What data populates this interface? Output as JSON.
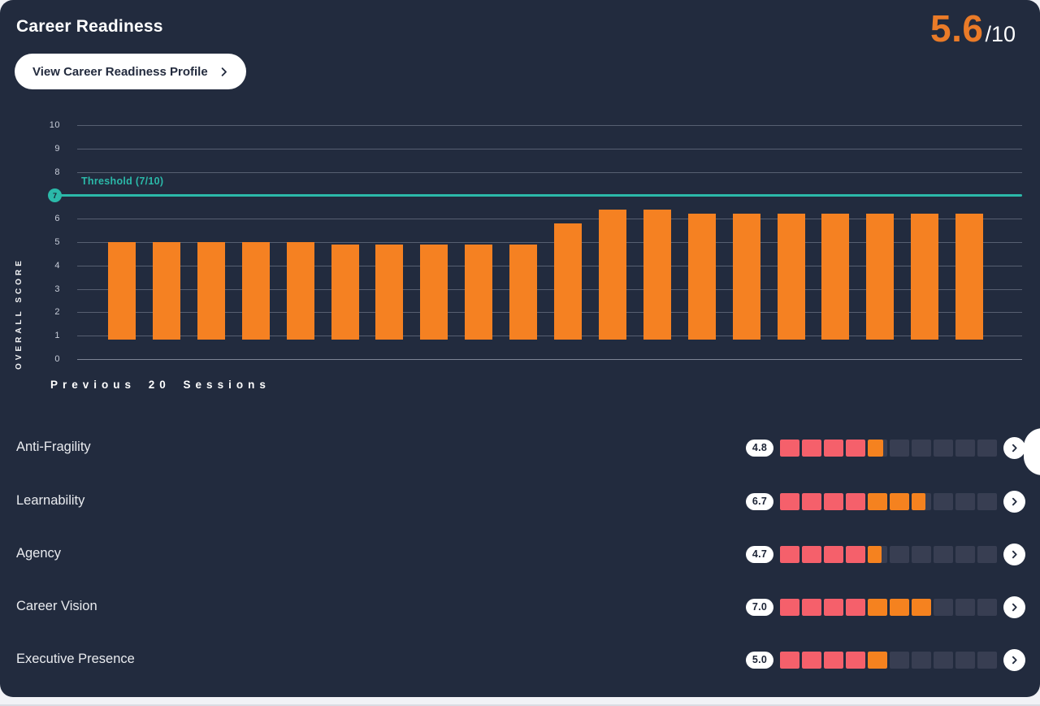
{
  "header": {
    "title": "Career Readiness",
    "score": "5.6",
    "score_max": "/10",
    "profile_button_label": "View Career Readiness Profile"
  },
  "chart_data": {
    "type": "bar",
    "title": "",
    "xlabel": "Previous 20 Sessions",
    "ylabel": "OVERALL SCORE",
    "ylim": [
      0,
      10
    ],
    "yticks": [
      0,
      1,
      2,
      3,
      4,
      5,
      6,
      7,
      8,
      9,
      10
    ],
    "grid": true,
    "values": [
      5.0,
      5.0,
      5.0,
      5.0,
      5.0,
      4.9,
      4.9,
      4.9,
      4.9,
      4.9,
      5.8,
      6.4,
      6.4,
      6.2,
      6.2,
      6.2,
      6.2,
      6.2,
      6.2,
      6.2
    ],
    "threshold": {
      "value": 7,
      "label": "Threshold (7/10)",
      "marker_text": "7"
    }
  },
  "skills": [
    {
      "label": "Anti-Fragility",
      "score": 4.8,
      "score_label": "4.8"
    },
    {
      "label": "Learnability",
      "score": 6.7,
      "score_label": "6.7"
    },
    {
      "label": "Agency",
      "score": 4.7,
      "score_label": "4.7"
    },
    {
      "label": "Career Vision",
      "score": 7.0,
      "score_label": "7.0"
    },
    {
      "label": "Executive Presence",
      "score": 5.0,
      "score_label": "5.0"
    }
  ],
  "icons": {
    "chevron_right": "chevron-right"
  },
  "colors": {
    "card_background": "#222B3E",
    "page_background": "#F1F2F6",
    "bar_orange": "#F58122",
    "score_orange": "#EA7B28",
    "threshold_teal": "#2BB9A9",
    "segment_red": "#F5606B",
    "segment_orange": "#F5821F",
    "segment_empty": "#383E52",
    "white": "#FFFFFF"
  }
}
